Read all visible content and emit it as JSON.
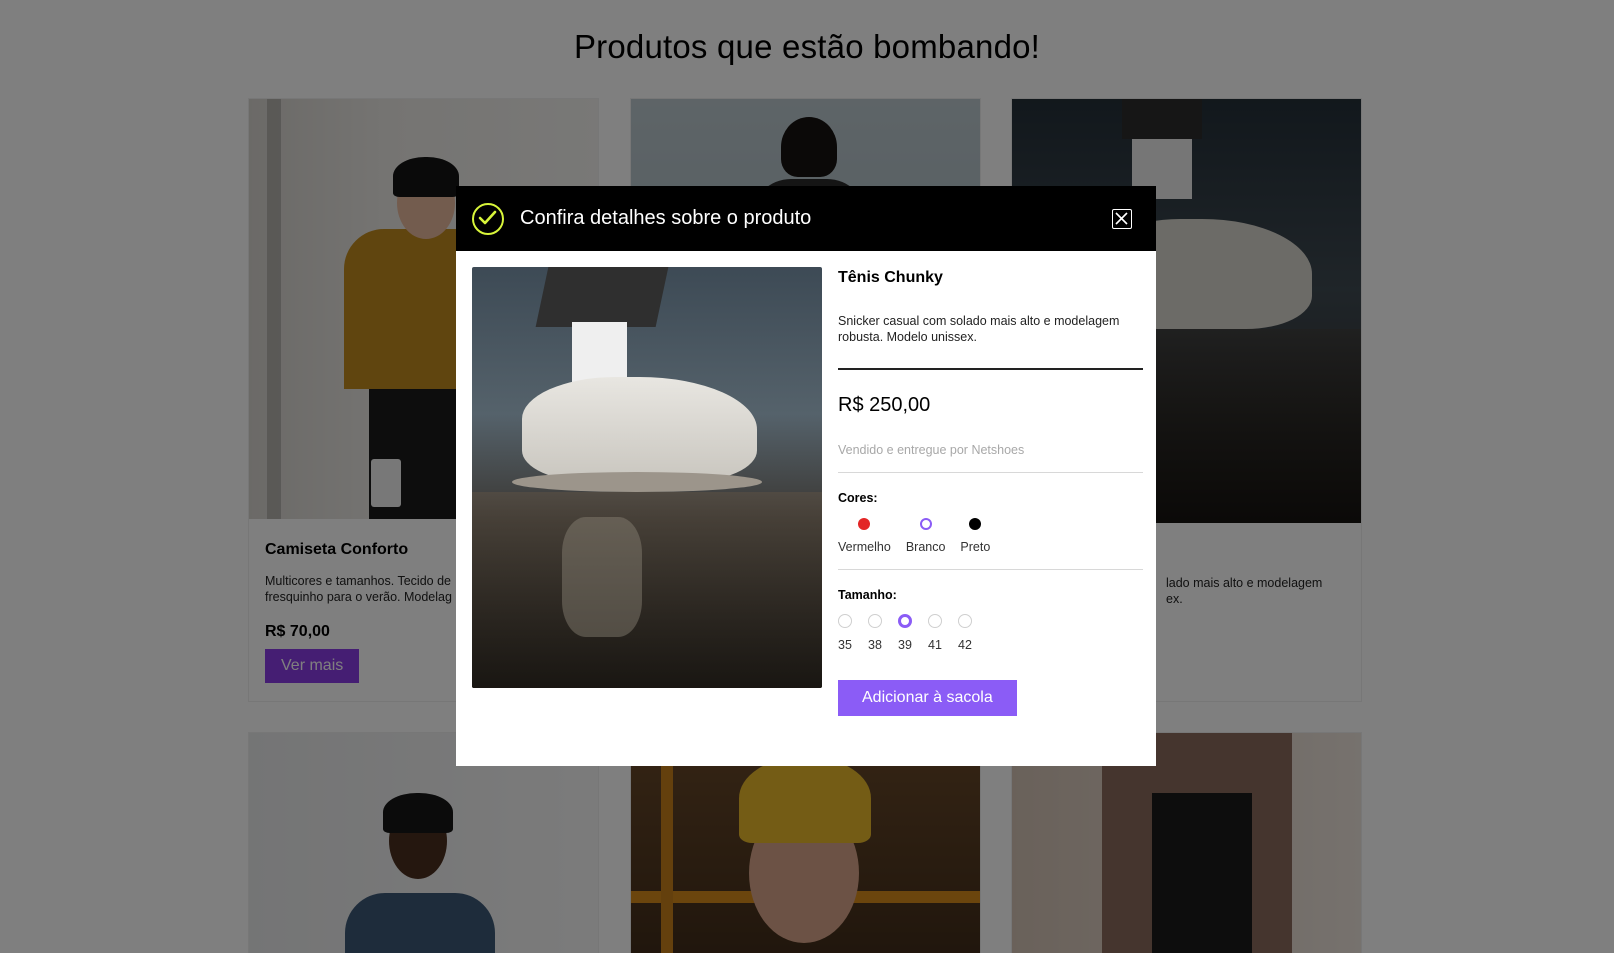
{
  "page": {
    "title": "Produtos que estão bombando!"
  },
  "cards": [
    {
      "name": "Camiseta Conforto",
      "desc_line1": "Multicores e tamanhos. Tecido de",
      "desc_line2": "fresquinho para o verão. Modelag",
      "price": "R$ 70,00",
      "button": "Ver mais"
    },
    {
      "desc_line1": "lado mais alto e modelagem",
      "desc_line2": "ex."
    }
  ],
  "modal": {
    "title": "Confira detalhes sobre o produto",
    "product": {
      "name": "Tênis Chunky",
      "description": "Snicker casual com solado mais alto e modelagem robusta. Modelo unissex.",
      "price": "R$ 250,00",
      "seller": "Vendido e entregue por Netshoes"
    },
    "colors_label": "Cores:",
    "colors": [
      {
        "label": "Vermelho",
        "color": "#e32626",
        "selected": false
      },
      {
        "label": "Branco",
        "color": "#ffffff",
        "selected": true
      },
      {
        "label": "Preto",
        "color": "#000000",
        "selected": false
      }
    ],
    "size_label": "Tamanho:",
    "sizes": [
      {
        "label": "35",
        "selected": false
      },
      {
        "label": "38",
        "selected": false
      },
      {
        "label": "39",
        "selected": true
      },
      {
        "label": "41",
        "selected": false
      },
      {
        "label": "42",
        "selected": false
      }
    ],
    "add_button": "Adicionar à sacola"
  },
  "theme": {
    "accent": "#8b5cf6",
    "button_purple": "#8b3ce6",
    "check_color": "#d8f53a"
  }
}
